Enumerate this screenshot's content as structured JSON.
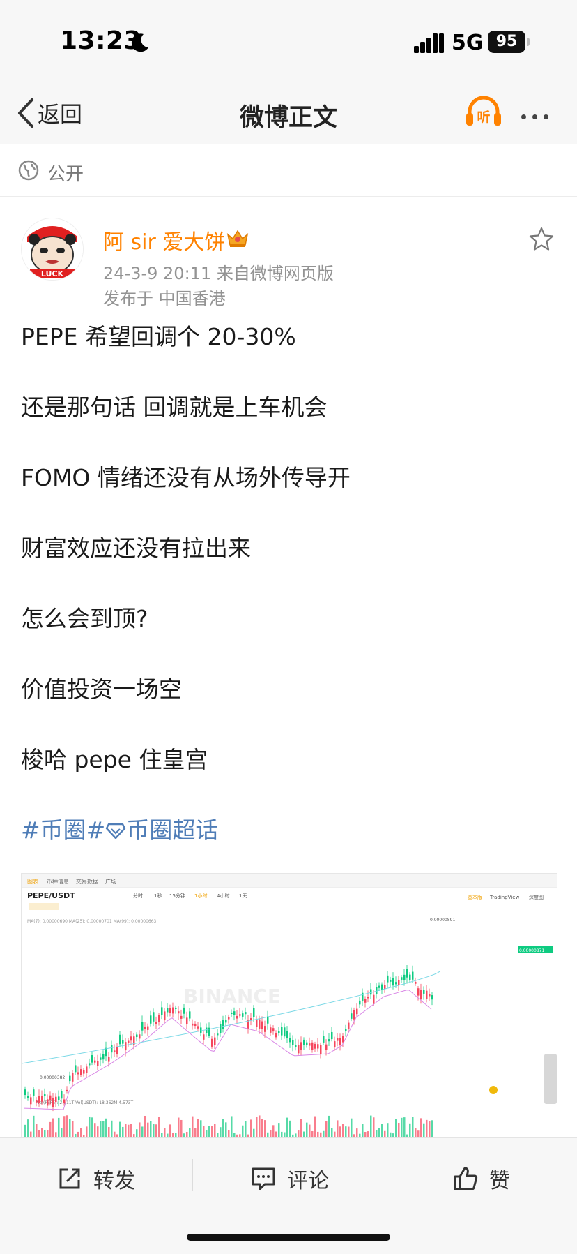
{
  "status": {
    "time": "13:23",
    "network": "5G",
    "battery": "95"
  },
  "nav": {
    "back_label": "返回",
    "title": "微博正文",
    "listen_icon_text": "听"
  },
  "privacy": {
    "label": "公开"
  },
  "author": {
    "name": "阿 sir 爱大饼",
    "time_source": "24-3-9 20:11  来自微博网页版",
    "location": "发布于 中国香港",
    "avatar_text": "LUCK"
  },
  "post": {
    "lines": [
      "PEPE 希望回调个 20-30%",
      "还是那句话  回调就是上车机会",
      "FOMO 情绪还没有从场外传导开",
      "财富效应还没有拉出来",
      "怎么会到顶?",
      "价值投资一场空",
      "梭哈 pepe 住皇宫"
    ],
    "hashtag1": "#币圈#",
    "hashtag2": "币圈超话"
  },
  "chart_image": {
    "tabs": [
      "图表",
      "币种信息",
      "交易数据",
      "广场"
    ],
    "pair": "PEPE/USDT",
    "intervals": [
      "分时",
      "1秒",
      "15分钟",
      "1小时",
      "4小时",
      "1天"
    ],
    "views": [
      "基本版",
      "TradingView",
      "深度图"
    ],
    "ma_line": "MA(7): 0.00000690  MA(25): 0.00000701  MA(99): 0.00000663",
    "high_label": "0.00000891",
    "low_label": "0.00000382",
    "price_tag": "0.00000871",
    "vol_label": "Vol(PEPE): 2.111T  Vol(USDT): 18.362M  4.573T",
    "watermark": "BINANCE",
    "colors": {
      "up": "#0ecb81",
      "down": "#f6465d",
      "ma7": "#f0b90b",
      "ma25": "#d987e6",
      "ma99": "#7ad8e6"
    }
  },
  "actions": {
    "repost": "转发",
    "comment": "评论",
    "like": "赞"
  },
  "colors": {
    "accent": "#ff8200",
    "link": "#4f7db7"
  }
}
